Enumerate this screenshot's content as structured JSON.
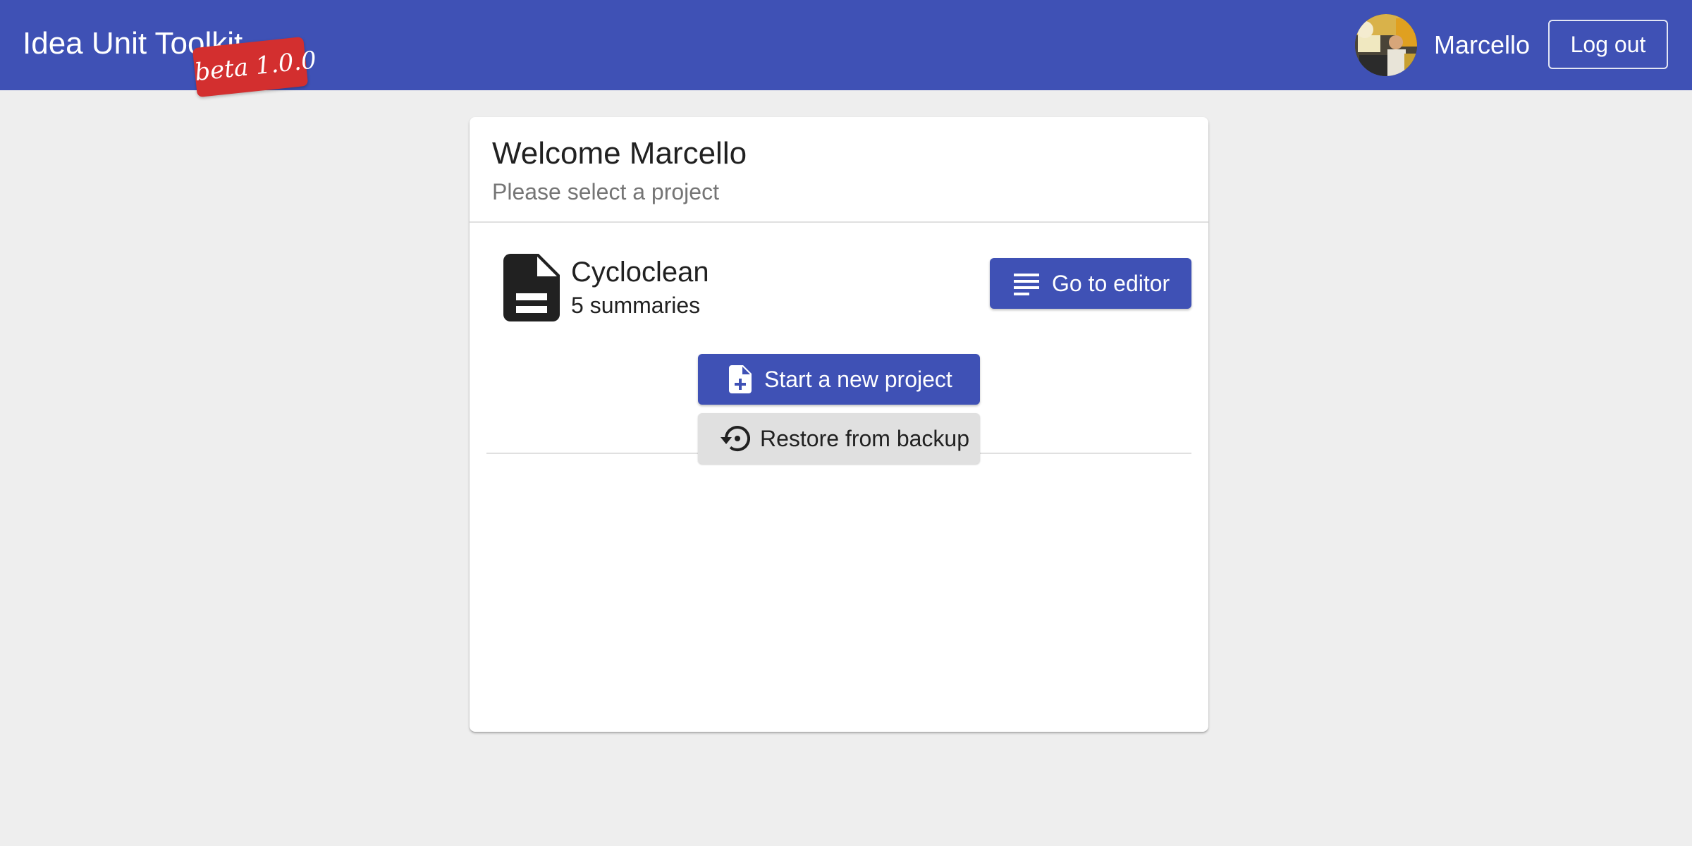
{
  "header": {
    "app_title": "Idea Unit Toolkit",
    "version_badge": "beta 1.0.0",
    "user_name": "Marcello",
    "logout_label": "Log out",
    "background_color": "#3f51b5",
    "badge_color": "#d32f2f"
  },
  "welcome": {
    "title": "Welcome Marcello",
    "subtitle": "Please select a project"
  },
  "projects": [
    {
      "name": "Cycloclean",
      "summary_count": "5 summaries",
      "icon": "document-icon",
      "action_label": "Go to editor",
      "action_icon": "notes-icon"
    }
  ],
  "actions": {
    "new_project_label": "Start a new project",
    "new_project_icon": "new-file-icon",
    "restore_label": "Restore from backup",
    "restore_icon": "restore-icon"
  },
  "colors": {
    "primary": "#3f51b5",
    "page_background": "#eeeeee",
    "secondary_button": "#e0e0e0"
  }
}
